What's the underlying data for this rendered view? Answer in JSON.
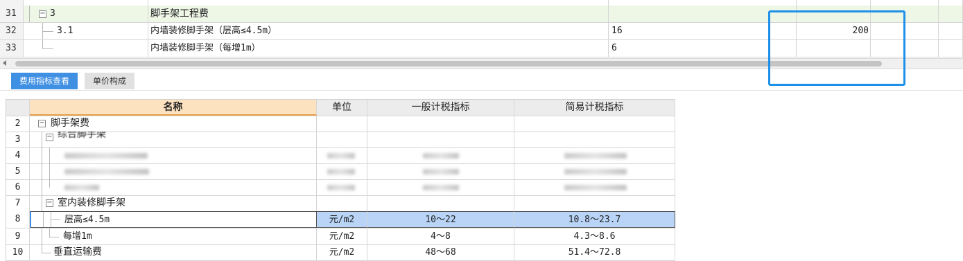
{
  "top_grid": {
    "rows": [
      {
        "num": "31",
        "code": "3",
        "name": "脚手架工程费",
        "qty": "",
        "value": ""
      },
      {
        "num": "32",
        "code": "3.1",
        "name": "内墙装修脚手架（层高≤4.5m）",
        "qty": "16",
        "value": "200"
      },
      {
        "num": "33",
        "code": "",
        "name": "内墙装修脚手架（每增1m）",
        "qty": "6",
        "value": ""
      }
    ]
  },
  "tabs": [
    {
      "label": "费用指标查看",
      "active": true
    },
    {
      "label": "单价构成",
      "active": false
    }
  ],
  "index_table": {
    "headers": {
      "name": "名称",
      "unit": "单位",
      "general": "一般计税指标",
      "simple": "简易计税指标"
    },
    "rows": [
      {
        "num": "2",
        "name": "脚手架费",
        "unit": "",
        "general": "",
        "simple": ""
      },
      {
        "num": "3",
        "name": "综合脚手架",
        "unit": "",
        "general": "",
        "simple": ""
      },
      {
        "num": "4",
        "name": "",
        "unit": "",
        "general": "",
        "simple": ""
      },
      {
        "num": "5",
        "name": "",
        "unit": "",
        "general": "",
        "simple": ""
      },
      {
        "num": "6",
        "name": "",
        "unit": "",
        "general": "",
        "simple": ""
      },
      {
        "num": "7",
        "name": "室内装修脚手架",
        "unit": "",
        "general": "",
        "simple": ""
      },
      {
        "num": "8",
        "name": "层高≤4.5m",
        "unit": "元/m2",
        "general": "10～22",
        "simple": "10.8～23.7"
      },
      {
        "num": "9",
        "name": "每增1m",
        "unit": "元/m2",
        "general": "4～8",
        "simple": "4.3～8.6"
      },
      {
        "num": "10",
        "name": "垂直运输费",
        "unit": "元/m2",
        "general": "48～68",
        "simple": "51.4～72.8"
      }
    ]
  },
  "colors": {
    "accent": "#3f8fe3",
    "selected_row": "#b9d4f6",
    "header_name": "#fde2c0",
    "group_row": "#eef6e6",
    "highlight_box": "#1e90e8"
  }
}
